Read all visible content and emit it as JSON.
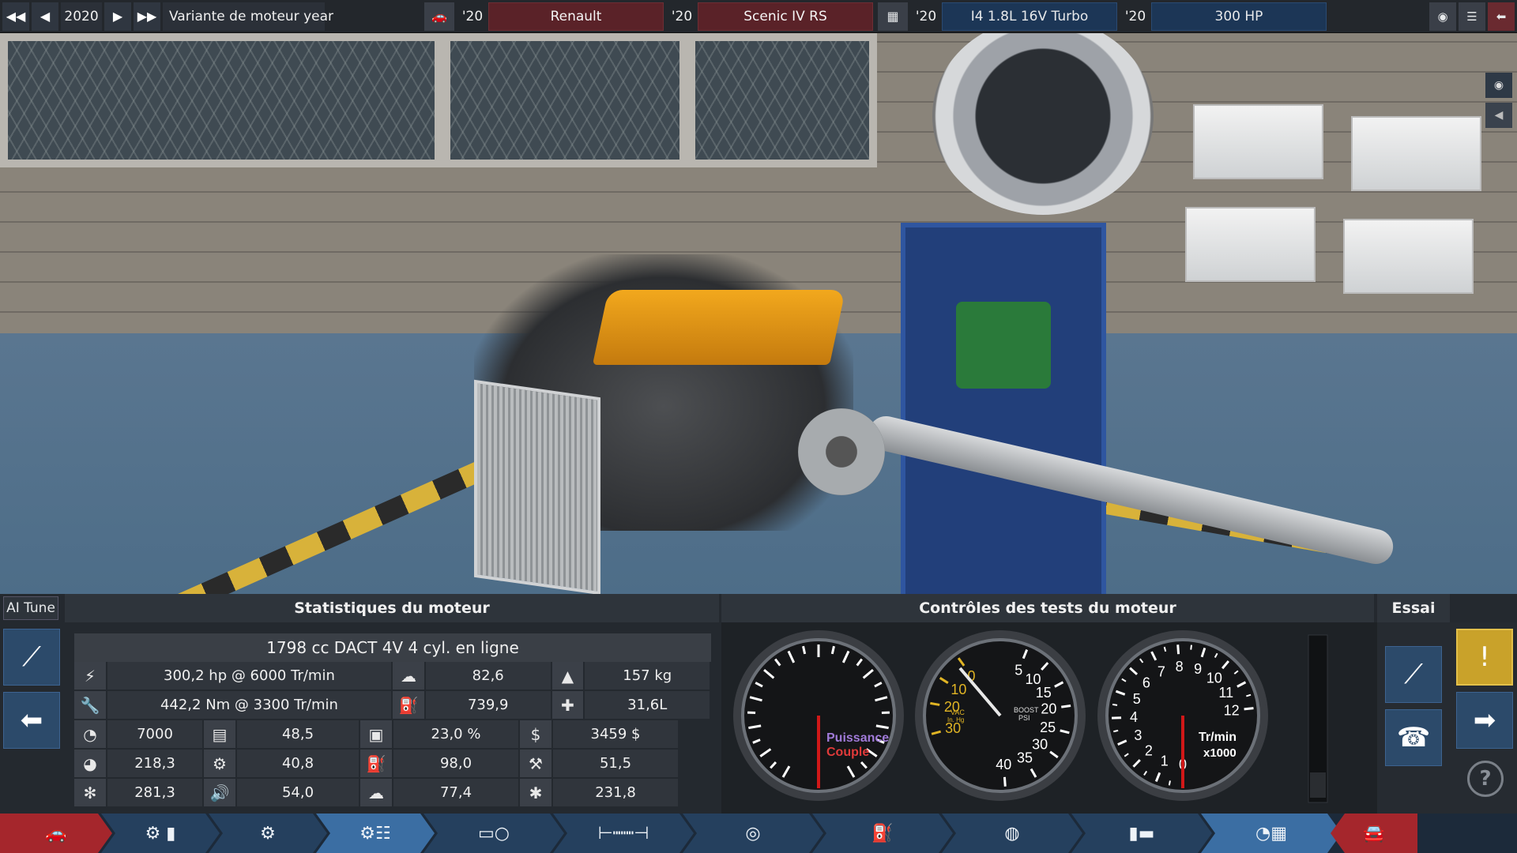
{
  "topbar": {
    "year": "2020",
    "variant_label": "Variante de moteur year",
    "car_year_1": "'20",
    "brand": "Renault",
    "car_year_2": "'20",
    "model": "Scenic IV RS",
    "engine_year_1": "'20",
    "engine": "I4 1.8L 16V Turbo",
    "engine_year_2": "'20",
    "power": "300 HP"
  },
  "panel": {
    "ai_tune": "AI Tune",
    "stats_header": "Statistiques du moteur",
    "tests_header": "Contrôles des tests du moteur",
    "essai_header": "Essai",
    "engine_summary": "1798 cc DACT 4V  4 cyl. en ligne"
  },
  "stats_rows": [
    {
      "a": "300,2 hp @ 6000 Tr/min",
      "b": "82,6",
      "c": "157 kg"
    },
    {
      "a": "442,2 Nm @ 3300 Tr/min",
      "b": "739,9",
      "c": "31,6L"
    },
    {
      "a1": "7000",
      "a2": "48,5",
      "b": "23,0 %",
      "c": "3459 $"
    },
    {
      "a1": "218,3",
      "a2": "40,8",
      "b": "98,0",
      "c": "51,5"
    },
    {
      "a1": "281,3",
      "a2": "54,0",
      "b": "77,4",
      "c": "231,8"
    }
  ],
  "gauges": {
    "power_label": "Puissance",
    "torque_label": "Couple",
    "boost_ticks_vac": [
      "30",
      "20",
      "10",
      "0"
    ],
    "boost_ticks_psi": [
      "5",
      "10",
      "15",
      "20",
      "25",
      "30",
      "35",
      "40"
    ],
    "boost_vac_label": "VAC",
    "boost_vac_unit": "In. Hg",
    "boost_psi_label": "BOOST",
    "boost_psi_unit": "PSI",
    "rpm_ticks": [
      "0",
      "1",
      "2",
      "3",
      "4",
      "5",
      "6",
      "7",
      "8",
      "9",
      "10",
      "11",
      "12"
    ],
    "rpm_label": "Tr/min",
    "rpm_unit": "x1000"
  },
  "colors": {
    "accent_blue": "#2c4a6a",
    "brand_red": "#5a2228",
    "warn_yellow": "#c9a22a",
    "needle_red": "#d01818",
    "power_text": "#a07ad8",
    "torque_text": "#e03a3a"
  },
  "nav_items": [
    {
      "icon": "car-body-icon"
    },
    {
      "icon": "engine-block-icon"
    },
    {
      "icon": "engine-heads-icon"
    },
    {
      "icon": "engine-tune-icon"
    },
    {
      "icon": "intake-icon"
    },
    {
      "icon": "camshaft-icon"
    },
    {
      "icon": "turbo-icon"
    },
    {
      "icon": "fuel-icon"
    },
    {
      "icon": "exhaust-icon"
    },
    {
      "icon": "muffler-icon"
    },
    {
      "icon": "dyno-test-icon"
    },
    {
      "icon": "car-export-icon"
    }
  ]
}
